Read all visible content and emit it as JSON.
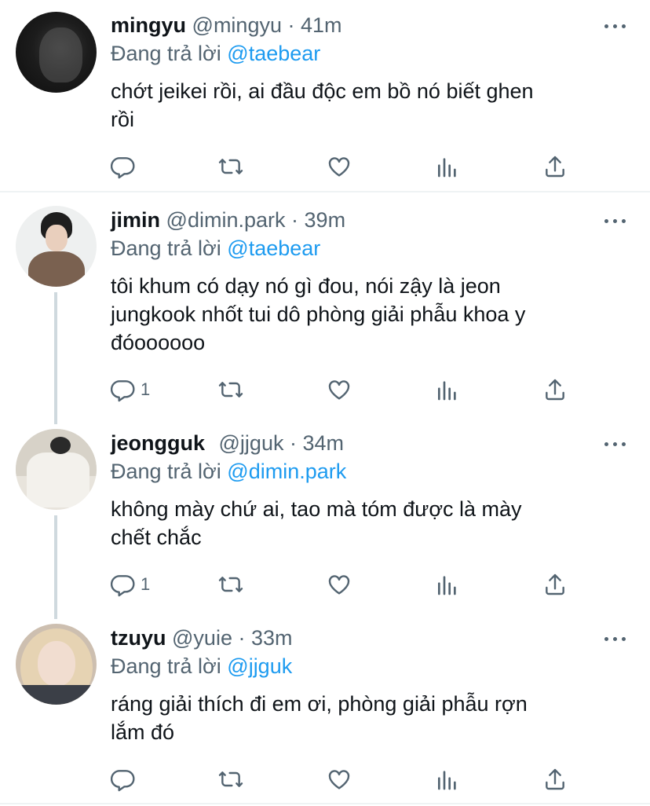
{
  "reply_prefix": "Đang trả lời",
  "tweets": [
    {
      "name": "mingyu",
      "handle": "@mingyu",
      "dot": "·",
      "time": "41m",
      "reply_to": "@taebear",
      "text_lines": [
        "chớt jeikei rồi, ai đầu độc em bồ nó biết ghen",
        "rồi"
      ],
      "reply_count": ""
    },
    {
      "name": "jimin",
      "handle": "@dimin.park",
      "dot": "·",
      "time": "39m",
      "reply_to": "@taebear",
      "text_lines": [
        "tôi khum có dạy nó gì đou, nói zậy là jeon",
        "jungkook nhốt tui dô phòng giải phẫu khoa y",
        "đóoooooo"
      ],
      "reply_count": "1"
    },
    {
      "name": "jeongguk",
      "handle": "@jjguk",
      "dot": "·",
      "time": "34m",
      "reply_to": "@dimin.park",
      "text_lines": [
        "không mày chứ ai, tao mà tóm được là mày",
        "chết chắc"
      ],
      "reply_count": "1"
    },
    {
      "name": "tzuyu",
      "handle": "@yuie",
      "dot": "·",
      "time": "33m",
      "reply_to": "@jjguk",
      "text_lines": [
        "ráng giải thích đi em ơi, phòng giải phẫu rợn",
        "lắm đó"
      ],
      "reply_count": ""
    }
  ],
  "colors": {
    "accent": "#1d9bf0",
    "muted": "#536471",
    "text": "#0f1419",
    "thread": "#cfd9de"
  },
  "icons": [
    "reply-icon",
    "retweet-icon",
    "like-icon",
    "views-icon",
    "share-icon",
    "more-icon"
  ]
}
